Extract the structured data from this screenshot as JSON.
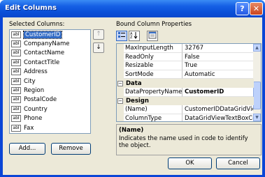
{
  "window": {
    "title": "Edit Columns",
    "help_glyph": "?",
    "close_glyph": "✕"
  },
  "left": {
    "label": "Selected Columns:",
    "icon_text": "abl",
    "columns": [
      "CustomerID",
      "CompanyName",
      "ContactName",
      "ContactTitle",
      "Address",
      "City",
      "Region",
      "PostalCode",
      "Country",
      "Phone",
      "Fax"
    ],
    "selected_index": 0,
    "move_up_glyph": "↑",
    "move_down_glyph": "↓",
    "add_label": "Add...",
    "remove_label": "Remove"
  },
  "right": {
    "label": "Bound Column Properties",
    "toolbar": [
      "categorized-icon",
      "alphabetical-icon",
      "property-pages-icon"
    ],
    "grid": [
      {
        "type": "prop",
        "name": "MaxInputLength",
        "value": "32767"
      },
      {
        "type": "prop",
        "name": "ReadOnly",
        "value": "False"
      },
      {
        "type": "prop",
        "name": "Resizable",
        "value": "True"
      },
      {
        "type": "prop",
        "name": "SortMode",
        "value": "Automatic"
      },
      {
        "type": "cat",
        "name": "Data",
        "glyph": "−"
      },
      {
        "type": "prop",
        "name": "DataPropertyName",
        "value": "CustomerID",
        "bold": true
      },
      {
        "type": "cat",
        "name": "Design",
        "glyph": "−"
      },
      {
        "type": "prop",
        "name": "(Name)",
        "value": "CustomerIDDataGridViewT"
      },
      {
        "type": "prop",
        "name": "ColumnType",
        "value": "DataGridViewTextBoxColu"
      }
    ],
    "description": {
      "title": "(Name)",
      "text": "Indicates the name used in code to identify the object."
    }
  },
  "buttons": {
    "ok": "OK",
    "cancel": "Cancel"
  },
  "colors": {
    "titlebar": "#0a4fd8",
    "dialog_bg": "#ece9d8",
    "selection": "#316ac5",
    "border": "#7f9db9"
  }
}
